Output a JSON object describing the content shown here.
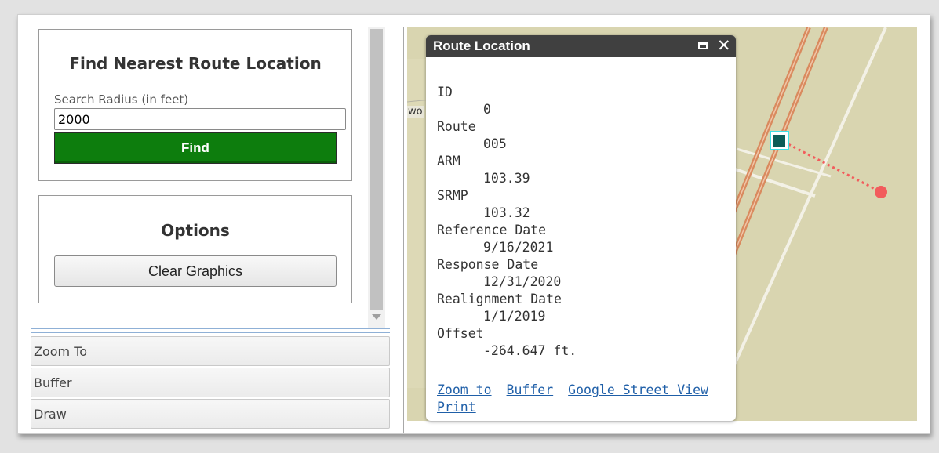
{
  "find_panel": {
    "title": "Find Nearest Route Location",
    "radius_label": "Search Radius (in feet)",
    "radius_value": "2000",
    "find_label": "Find",
    "find_color": "#0d7d0d"
  },
  "options_panel": {
    "title": "Options",
    "clear_label": "Clear Graphics"
  },
  "sections": [
    "Zoom To",
    "Buffer",
    "Draw"
  ],
  "map": {
    "edge_label": "wo",
    "route_color": "#d98a5e",
    "road_color": "#f3f1e6",
    "marker_color": "#0b5c57",
    "target_color": "#f25c5c"
  },
  "popup": {
    "title": "Route Location",
    "attributes": [
      {
        "label": "ID",
        "value": "0"
      },
      {
        "label": "Route",
        "value": "005"
      },
      {
        "label": "ARM",
        "value": "103.39"
      },
      {
        "label": "SRMP",
        "value": "103.32"
      },
      {
        "label": "Reference Date",
        "value": "9/16/2021"
      },
      {
        "label": "Response Date",
        "value": "12/31/2020"
      },
      {
        "label": "Realignment Date",
        "value": "1/1/2019"
      },
      {
        "label": "Offset",
        "value": "-264.647 ft."
      }
    ],
    "links": [
      "Zoom to",
      "Buffer",
      "Google Street View",
      "Print"
    ]
  }
}
